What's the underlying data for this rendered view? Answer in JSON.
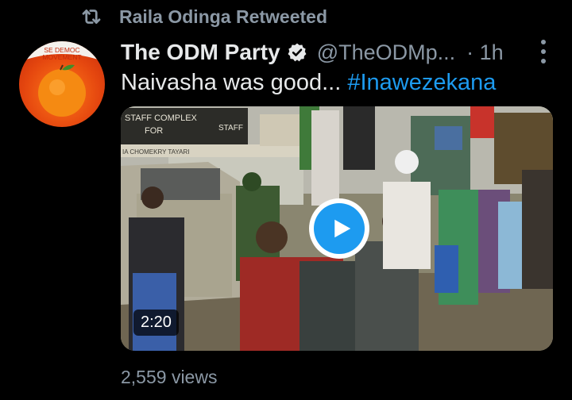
{
  "retweet": {
    "icon": "retweet-icon",
    "label": "Raila Odinga Retweeted"
  },
  "author": {
    "avatar_text": "SE DEMOC\nMOVEMENT",
    "name": "The ODM Party",
    "verified_icon": "verified-badge-icon",
    "handle": "@TheODMp...",
    "time": "· 1h"
  },
  "tweet": {
    "text": "Naivasha was good... ",
    "hashtag": "#Inawezekana"
  },
  "media": {
    "sign_text_1": "STAFF COMPLEX",
    "sign_text_2": "FOR",
    "sign_text_3": "IA CHOMEKRY TAYARI",
    "sign_text_4": "STAFF",
    "duration": "2:20",
    "play_icon": "play-icon"
  },
  "stats": {
    "views": "2,559 views"
  },
  "colors": {
    "background": "#000000",
    "accent": "#1d9bf0",
    "muted": "#8b98a5",
    "text": "#e7e9ea"
  }
}
